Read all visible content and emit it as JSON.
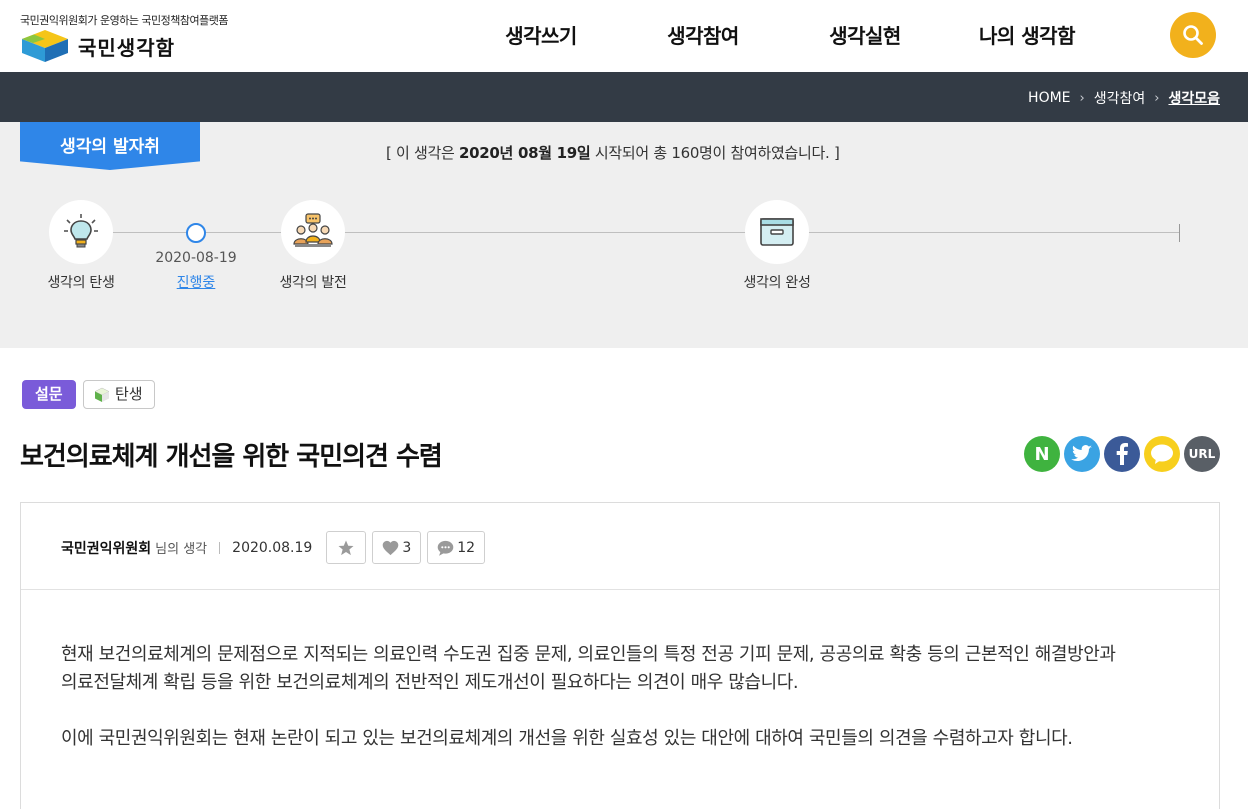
{
  "header": {
    "tagline": "국민권익위원회가 운영하는 국민정책참여플랫폼",
    "logo_text": "국민생각함",
    "nav": [
      "생각쓰기",
      "생각참여",
      "생각실현",
      "나의 생각함"
    ],
    "search_icon": "search-icon",
    "accent_color": "#f2b11c"
  },
  "breadcrumb": {
    "items": [
      "HOME",
      "생각참여",
      "생각모음"
    ]
  },
  "progress": {
    "ribbon_label": "생각의 발자취",
    "notice_prefix": "[ 이 생각은 ",
    "notice_date": "2020년 08월 19일",
    "notice_suffix": " 시작되어 총 160명이 참여하였습니다. ]",
    "stages": [
      "생각의 탄생",
      "생각의 발전",
      "생각의 완성"
    ],
    "current_date": "2020-08-19",
    "current_status": "진행중"
  },
  "post": {
    "type_tag": "설문",
    "stage_tag": "탄생",
    "title": "보건의료체계 개선을 위한 국민의견 수렴",
    "share": {
      "naver": "N",
      "url": "URL"
    },
    "author": "국민권익위원회",
    "author_suffix": "님의 생각",
    "date": "2020.08.19",
    "likes": "3",
    "comments": "12",
    "body": [
      "현재 보건의료체계의 문제점으로 지적되는 의료인력 수도권 집중 문제,  의료인들의 특정 전공 기피 문제,  공공의료 확충 등의 근본적인 해결방안과",
      "의료전달체계 확립 등을 위한 보건의료체계의 전반적인 제도개선이 필요하다는 의견이 매우 많습니다.",
      "이에 국민권익위원회는 현재 논란이 되고 있는 보건의료체계의 개선을 위한 실효성 있는 대안에 대하여 국민들의 의견을 수렴하고자 합니다."
    ]
  }
}
